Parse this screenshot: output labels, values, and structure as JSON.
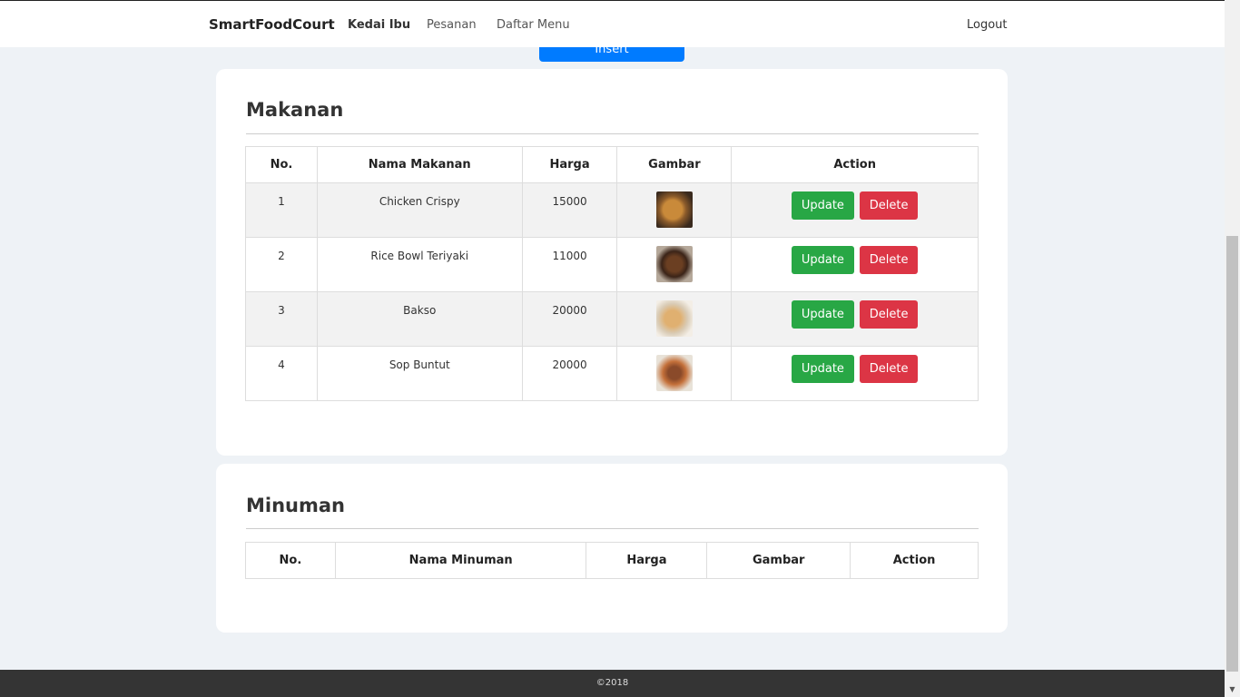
{
  "nav": {
    "brand": "SmartFoodCourt",
    "links": [
      "Kedai Ibu",
      "Pesanan",
      "Daftar Menu"
    ],
    "logout": "Logout"
  },
  "insert_label": "Insert",
  "makanan": {
    "title": "Makanan",
    "headers": [
      "No.",
      "Nama Makanan",
      "Harga",
      "Gambar",
      "Action"
    ],
    "rows": [
      {
        "no": "1",
        "name": "Chicken Crispy",
        "price": "15000",
        "image": "chicken-crispy-photo"
      },
      {
        "no": "2",
        "name": "Rice Bowl Teriyaki",
        "price": "11000",
        "image": "rice-bowl-photo"
      },
      {
        "no": "3",
        "name": "Bakso",
        "price": "20000",
        "image": "bakso-photo"
      },
      {
        "no": "4",
        "name": "Sop Buntut",
        "price": "20000",
        "image": "sop-buntut-photo"
      }
    ],
    "update_label": "Update",
    "delete_label": "Delete"
  },
  "minuman": {
    "title": "Minuman",
    "headers": [
      "No.",
      "Nama Minuman",
      "Harga",
      "Gambar",
      "Action"
    ]
  },
  "footer": "©2018",
  "colors": {
    "primary": "#007bff",
    "success": "#28a745",
    "danger": "#dc3545",
    "background": "#eef2f6"
  }
}
